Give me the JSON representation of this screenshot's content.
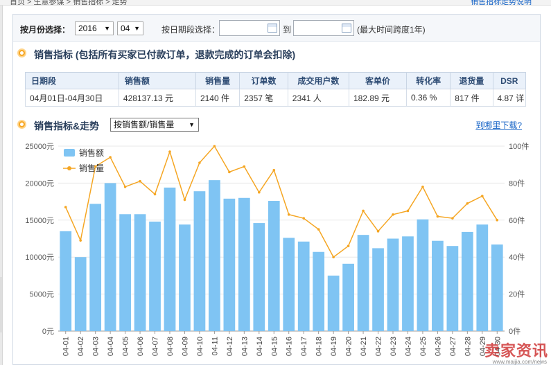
{
  "top": {
    "crumb": "首页 > 生意参谋 > 销售指标 > 走势",
    "link": "销售指标走势说明"
  },
  "filter": {
    "by_month_label": "按月份选择：",
    "year": "2016",
    "month": "04",
    "by_date_label": "按日期段选择：",
    "date_from": "",
    "to_label": "到",
    "date_to": "",
    "note": "(最大时间跨度1年)"
  },
  "section1": {
    "title": "销售指标 (包括所有买家已付款订单，退款完成的订单会扣除)"
  },
  "table": {
    "headers": [
      "日期段",
      "销售额",
      "销售量",
      "订单数",
      "成交用户数",
      "客单价",
      "转化率",
      "退货量",
      "DSR"
    ],
    "row": [
      "04月01日-04月30日",
      "428137.13 元",
      "2140 件",
      "2357 笔",
      "2341 人",
      "182.89 元",
      "0.36 %",
      "817 件",
      "4.87 详"
    ]
  },
  "section2": {
    "title": "销售指标&走势",
    "metric_select": "按销售额/销售量",
    "download_link": "到哪里下载?"
  },
  "colors": {
    "bar": "#7fc4f3",
    "line": "#f5a623"
  },
  "chart_data": {
    "type": "bar",
    "categories": [
      "04-01",
      "04-02",
      "04-03",
      "04-04",
      "04-05",
      "04-06",
      "04-07",
      "04-08",
      "04-09",
      "04-10",
      "04-11",
      "04-12",
      "04-13",
      "04-14",
      "04-15",
      "04-16",
      "04-17",
      "04-18",
      "04-19",
      "04-20",
      "04-21",
      "04-22",
      "04-23",
      "04-24",
      "04-25",
      "04-26",
      "04-27",
      "04-28",
      "04-29",
      "04-30"
    ],
    "series": [
      {
        "name": "销售额",
        "type": "bar",
        "axis": "left",
        "values": [
          13500,
          10000,
          17200,
          20000,
          15800,
          15800,
          14800,
          19400,
          14400,
          18900,
          20400,
          17900,
          18000,
          14600,
          17600,
          12600,
          12100,
          10700,
          7500,
          9100,
          13000,
          11200,
          12500,
          12800,
          15100,
          12200,
          11500,
          13400,
          14400,
          11700
        ]
      },
      {
        "name": "销售量",
        "type": "line",
        "axis": "right",
        "values": [
          67,
          49,
          89,
          94,
          78,
          81,
          74,
          97,
          71,
          91,
          100,
          86,
          89,
          75,
          87,
          63,
          61,
          55,
          40,
          46,
          65,
          54,
          63,
          65,
          78,
          62,
          61,
          69,
          73,
          60
        ]
      }
    ],
    "ylim_left": [
      0,
      25000
    ],
    "ylim_right": [
      0,
      100
    ],
    "yticks_left": [
      "0元",
      "5000元",
      "10000元",
      "15000元",
      "20000元",
      "25000元"
    ],
    "yticks_right": [
      "0件",
      "20件",
      "40件",
      "60件",
      "80件",
      "100件"
    ],
    "legend": "top-left",
    "grid": true
  },
  "watermark": {
    "text": "卖家资讯",
    "url": "www.maijia.com/news"
  }
}
